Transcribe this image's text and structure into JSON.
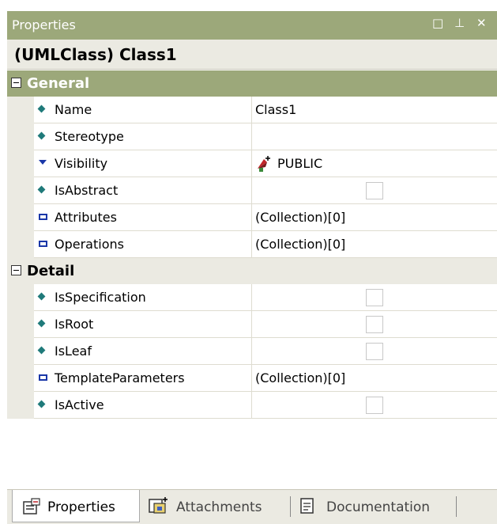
{
  "window": {
    "title": "Properties",
    "controls": {
      "restore": "□",
      "pin": "⊥",
      "close": "✕"
    }
  },
  "selection": {
    "header": "(UMLClass) Class1"
  },
  "categories": [
    {
      "label": "General",
      "rows": [
        {
          "name": "Name",
          "value": "Class1",
          "icon": "property-diamond-icon"
        },
        {
          "name": "Stereotype",
          "value": "",
          "icon": "property-diamond-icon"
        },
        {
          "name": "Visibility",
          "value": "PUBLIC",
          "icon": "dropdown-triangle-icon"
        },
        {
          "name": "IsAbstract",
          "value": "",
          "icon": "property-diamond-icon"
        },
        {
          "name": "Attributes",
          "value": "(Collection)[0]",
          "icon": "collection-icon"
        },
        {
          "name": "Operations",
          "value": "(Collection)[0]",
          "icon": "collection-icon"
        }
      ]
    },
    {
      "label": "Detail",
      "rows": [
        {
          "name": "IsSpecification",
          "value": "",
          "icon": "property-diamond-icon"
        },
        {
          "name": "IsRoot",
          "value": "",
          "icon": "property-diamond-icon"
        },
        {
          "name": "IsLeaf",
          "value": "",
          "icon": "property-diamond-icon"
        },
        {
          "name": "TemplateParameters",
          "value": "(Collection)[0]",
          "icon": "collection-icon"
        },
        {
          "name": "IsActive",
          "value": "",
          "icon": "property-diamond-icon"
        }
      ]
    }
  ],
  "tabs": [
    {
      "label": "Properties",
      "active": true
    },
    {
      "label": "Attachments",
      "active": false
    },
    {
      "label": "Documentation",
      "active": false
    }
  ],
  "colors": {
    "accent": "#9ca87a",
    "panel": "#ebeae2",
    "icon_teal": "#1f7a7a",
    "icon_blue": "#1a37a8"
  }
}
